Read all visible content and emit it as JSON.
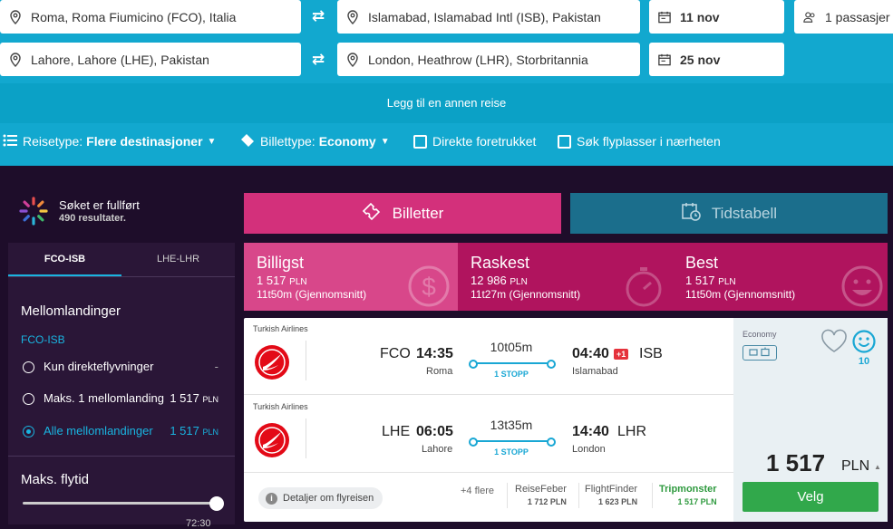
{
  "search": {
    "legs": [
      {
        "from": "Roma, Roma Fiumicino (FCO), Italia",
        "to": "Islamabad, Islamabad Intl (ISB), Pakistan",
        "date": "11 nov"
      },
      {
        "from": "Lahore, Lahore (LHE), Pakistan",
        "to": "London, Heathrow (LHR), Storbritannia",
        "date": "25 nov"
      }
    ],
    "passengers": "1 passasjer",
    "swap_icon": "⇄",
    "add_trip": "Legg til en annen reise"
  },
  "options": {
    "trip_type_label": "Reisetype:",
    "trip_type_value": "Flere destinasjoner",
    "ticket_type_label": "Billettype:",
    "ticket_type_value": "Economy",
    "direct_preferred": "Direkte foretrukket",
    "nearby_airports": "Søk flyplasser i nærheten"
  },
  "status": {
    "title": "Søket er fullført",
    "count": "490 resultater."
  },
  "sidebar": {
    "tabs": [
      "FCO-ISB",
      "LHE-LHR"
    ],
    "stops_title": "Mellomlandinger",
    "stops_leg": "FCO-ISB",
    "stop_options": [
      {
        "label": "Kun direkteflyvninger",
        "price": "-",
        "currency": ""
      },
      {
        "label": "Maks. 1 mellomlanding",
        "price": "1 517",
        "currency": "PLN"
      },
      {
        "label": "Alle mellomlandinger",
        "price": "1 517",
        "currency": "PLN"
      }
    ],
    "max_duration_title": "Maks. flytid",
    "max_duration_value": "72:30"
  },
  "views": {
    "tickets": "Billetter",
    "timetable": "Tidstabell"
  },
  "sort_tabs": [
    {
      "title": "Billigst",
      "price": "1 517",
      "currency": "PLN",
      "duration": "11t50m (Gjennomsnitt)"
    },
    {
      "title": "Raskest",
      "price": "12 986",
      "currency": "PLN",
      "duration": "11t27m (Gjennomsnitt)"
    },
    {
      "title": "Best",
      "price": "1 517",
      "currency": "PLN",
      "duration": "11t50m (Gjennomsnitt)"
    }
  ],
  "result": {
    "segments": [
      {
        "airline": "Turkish Airlines",
        "from_code": "FCO",
        "dep_time": "14:35",
        "from_city": "Roma",
        "duration": "10t05m",
        "stops": "1 STOPP",
        "arr_time": "04:40",
        "day_offset": "+1",
        "to_code": "ISB",
        "to_city": "Islamabad"
      },
      {
        "airline": "Turkish Airlines",
        "from_code": "LHE",
        "dep_time": "06:05",
        "from_city": "Lahore",
        "duration": "13t35m",
        "stops": "1 STOPP",
        "arr_time": "14:40",
        "day_offset": "",
        "to_code": "LHR",
        "to_city": "London"
      }
    ],
    "details_button": "Detaljer om flyreisen",
    "more_providers": "+4 flere",
    "providers": [
      {
        "name": "ReiseFeber",
        "price": "1 712 PLN"
      },
      {
        "name": "FlightFinder",
        "price": "1 623 PLN"
      },
      {
        "name": "Tripmonster",
        "price": "1 517 PLN"
      }
    ],
    "cabin": "Economy",
    "score": "10",
    "price": "1 517",
    "currency": "PLN",
    "select_button": "Velg"
  },
  "colors": {
    "header": "#12a8cf",
    "pink": "#d3307b",
    "magenta": "#b0145e",
    "green": "#31a84b",
    "dark": "#1e0d2a"
  }
}
